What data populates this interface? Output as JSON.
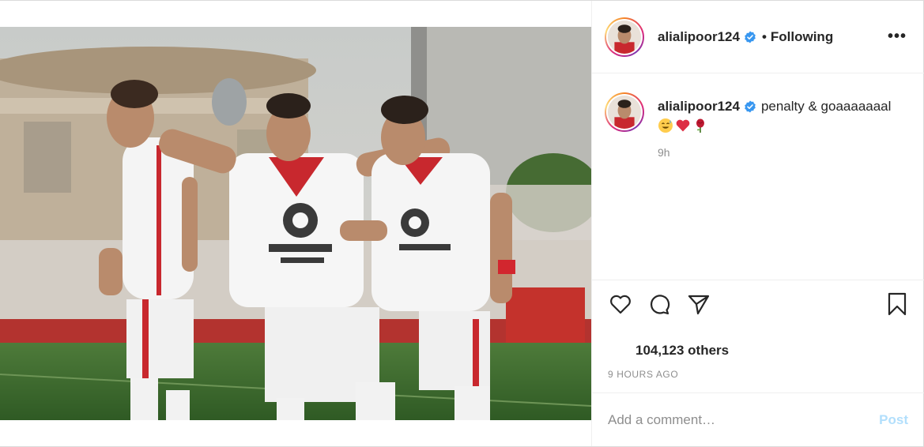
{
  "post": {
    "header": {
      "username": "alialipoor124",
      "separator": "•",
      "follow_state": "Following",
      "more_label": "•••"
    },
    "caption": {
      "username": "alialipoor124",
      "text": "penalty & goaaaaaaal",
      "emojis": [
        "sweat-smile-emoji",
        "red-heart-emoji",
        "rose-emoji"
      ],
      "time": "9h"
    },
    "likes_text": "104,123 others",
    "time_ago": "9 HOURS AGO",
    "comment": {
      "placeholder": "Add a comment…",
      "post_label": "Post"
    },
    "icons": {
      "like": "heart-icon",
      "comment": "comment-icon",
      "share": "share-icon",
      "save": "bookmark-icon",
      "verified": "verified-badge-icon"
    },
    "colors": {
      "verified_blue": "#3897f0",
      "post_disabled": "#b2dffc",
      "muted_text": "#8e8e8e"
    }
  }
}
